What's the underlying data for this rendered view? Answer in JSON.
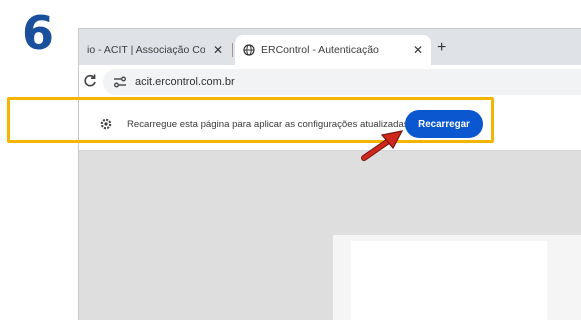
{
  "step": {
    "number": "6"
  },
  "colors": {
    "step_blue": "#1a4f9c",
    "highlight": "#f5b400",
    "button_blue": "#0b57d0",
    "arrow_red": "#d0271d"
  },
  "tabs": [
    {
      "title": "io - ACIT | Associação Come",
      "icon": "none",
      "active": false
    },
    {
      "title": "ERControl - Autenticação",
      "icon": "globe-icon",
      "active": true
    }
  ],
  "tab_close_label": "✕",
  "new_tab_label": "+",
  "address_bar": {
    "url": "acit.ercontrol.com.br"
  },
  "infobar": {
    "message": "Recarregue esta página para aplicar as configurações atualizadas ao site.",
    "button_label": "Recarregar"
  }
}
